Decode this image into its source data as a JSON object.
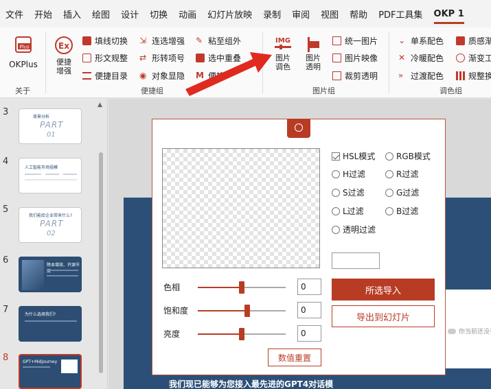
{
  "menu": [
    "文件",
    "开始",
    "插入",
    "绘图",
    "设计",
    "切换",
    "动画",
    "幻灯片放映",
    "录制",
    "审阅",
    "视图",
    "帮助",
    "PDF工具集",
    "OKP 1"
  ],
  "ribbon": {
    "okplus": {
      "badge": "Plus",
      "label": "OKPlus",
      "group": "关于"
    },
    "convenience": {
      "label_line1": "便捷",
      "label_line2": "增强"
    },
    "col1": [
      "填线切换",
      "形文规整",
      "便捷目录"
    ],
    "col2": [
      "连选增强",
      "形转项号",
      "对象显隐"
    ],
    "col3": [
      "粘至组外",
      "选中重叠",
      "便捷"
    ],
    "convenience_group": "便捷组",
    "img_adjust": {
      "icon_text": "IMG",
      "line1": "图片",
      "line2": "调色"
    },
    "img_transparent": {
      "line1": "图片",
      "line2": "透明"
    },
    "img_col": [
      "统一图片",
      "图片映像",
      "裁剪透明"
    ],
    "image_group": "图片组",
    "color_col1": [
      "单系配色",
      "冷暖配色",
      "过渡配色"
    ],
    "color_col2": [
      "质感渐",
      "渐变工",
      "规整换"
    ],
    "color_group": "调色组"
  },
  "slides": [
    {
      "num": "3",
      "title": "背景分析",
      "part": "PART",
      "sub": "01",
      "style": "light"
    },
    {
      "num": "4",
      "title": "人工智能市场规模",
      "style": "light"
    },
    {
      "num": "5",
      "title": "我们能给企业带来什么?",
      "part": "PART",
      "sub": "02",
      "style": "light"
    },
    {
      "num": "6",
      "title": "降本增效、开源节流",
      "style": "dark"
    },
    {
      "num": "7",
      "title": "为什么选择我们?",
      "style": "dark"
    },
    {
      "num": "8",
      "title": "GPT+Midjourney",
      "style": "dark-selected"
    }
  ],
  "dialog": {
    "modes": [
      {
        "label": "HSL模式",
        "checked": true
      },
      {
        "label": "RGB模式",
        "checked": false
      },
      {
        "label": "H过滤",
        "checked": false
      },
      {
        "label": "R过滤",
        "checked": false
      },
      {
        "label": "S过滤",
        "checked": false
      },
      {
        "label": "G过滤",
        "checked": false
      },
      {
        "label": "L过滤",
        "checked": false
      },
      {
        "label": "B过滤",
        "checked": false
      },
      {
        "label": "透明过滤",
        "checked": false
      }
    ],
    "color_value": "",
    "sliders": [
      {
        "label": "色相",
        "value": "0",
        "level": 0.5
      },
      {
        "label": "饱和度",
        "value": "0",
        "level": 0.56
      },
      {
        "label": "亮度",
        "value": "0",
        "level": 0.5
      }
    ],
    "reset_label": "数值重置",
    "import_label": "所选导入",
    "export_label": "导出到幻灯片"
  },
  "canvas": {
    "caption": "我们现已能够为您接入最先进的GPT4对话模",
    "side_hint": "你当前还没有"
  },
  "colors": {
    "accent": "#b83c24",
    "slide_dark": "#2c4f78"
  }
}
